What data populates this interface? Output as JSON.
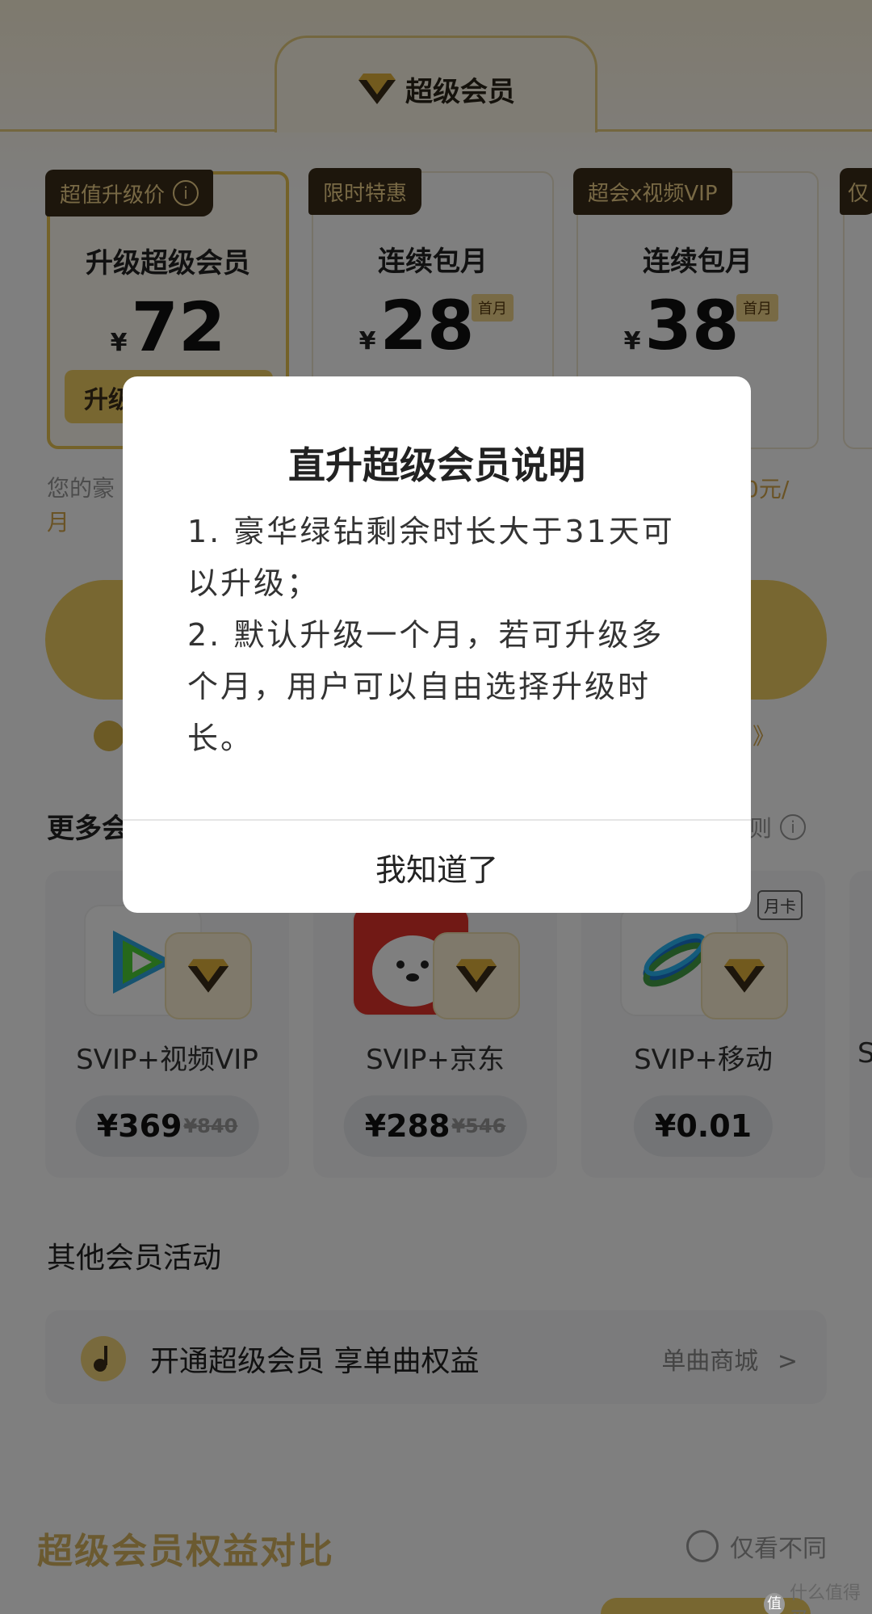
{
  "header": {
    "title": "超级会员"
  },
  "plans": [
    {
      "badge": "超值升级价",
      "name": "升级超级会员",
      "currency": "¥",
      "price": "72",
      "button": "升级"
    },
    {
      "badge": "限时特惠",
      "name": "连续包月",
      "currency": "¥",
      "price": "28",
      "tag": "首月"
    },
    {
      "badge": "超会x视频VIP",
      "name": "连续包月",
      "currency": "¥",
      "price": "38",
      "tag": "首月"
    },
    {
      "badge": "仅"
    }
  ],
  "notes": {
    "left_line1": "您的豪",
    "left_line2": "月",
    "right": "0元/"
  },
  "more_section": {
    "title": "更多会",
    "rules": "规则",
    "more_arrow": "》"
  },
  "bundles": [
    {
      "name": "SVIP+视频VIP",
      "price": "¥369",
      "old_price": "¥840",
      "logo_color": "#2ea7e0"
    },
    {
      "name": "SVIP+京东",
      "price": "¥288",
      "old_price": "¥546",
      "logo_color": "#e3322b"
    },
    {
      "name": "SVIP+移动",
      "price": "¥0.01",
      "tag": "月卡",
      "logo_color": "#1976d2"
    },
    {
      "name": "S"
    }
  ],
  "other_section": {
    "title": "其他会员活动"
  },
  "activity": {
    "text": "开通超级会员 享单曲权益",
    "link": "单曲商城",
    "chevron": ">"
  },
  "compare": {
    "title": "超级会员权益对比",
    "toggle": "仅看不同"
  },
  "watermark": {
    "text": "什么值得买",
    "icon": "值"
  },
  "modal": {
    "title": "直升超级会员说明",
    "line1": "1. 豪华绿钻剩余时长大于31天可以升级；",
    "line2": "2. 默认升级一个月，若可升级多个月，用户可以自由选择升级时长。",
    "button": "我知道了"
  },
  "colors": {
    "gold": "#f1cf63",
    "dark_badge": "#3a2c18",
    "overlay": "rgba(0,0,0,0.5)"
  }
}
